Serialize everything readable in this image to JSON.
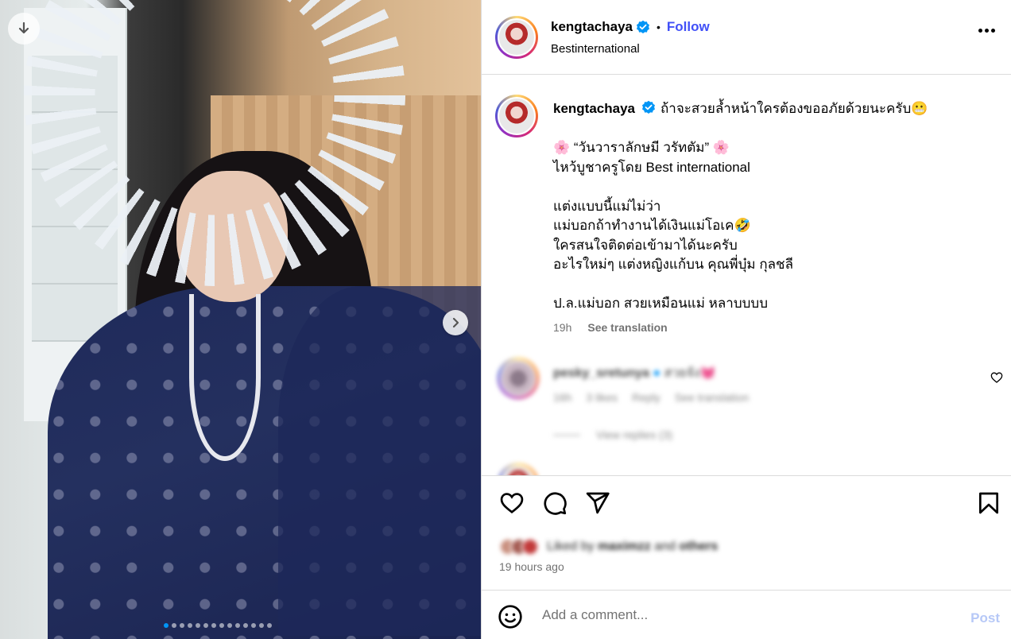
{
  "post": {
    "username": "kengtachaya",
    "follow_label": "Follow",
    "separator": "•",
    "location": "Bestinternational",
    "caption_lines": [
      "ถ้าจะสวยล้ำหน้าใครต้องขออภัยด้วยนะครับ😬",
      "",
      "🌸 “วันวาราลักษมี วรัทตัม” 🌸",
      "ไหว้บูชาครูโดย Best international",
      "",
      "แต่งแบบนี้แม่ไม่ว่า",
      "แม่บอกถ้าทำงานได้เงินแม่โอเค🤣",
      "ใครสนใจติดต่อเข้ามาได้นะครับ",
      "อะไรใหม่ๆ แต่งหญิงแก้บน คุณพี่บุ๋ม กุลชลี",
      "",
      "ป.ล.แม่บอก สวยเหมือนแม่ หลาบบบบ"
    ],
    "caption_time": "19h",
    "see_translation": "See translation",
    "liked_by_prefix": "Liked by",
    "liked_by_user": "maximzz",
    "liked_by_and": "and",
    "liked_by_others": "others",
    "posted_ago": "19 hours ago"
  },
  "comments": [
    {
      "username": "pesky_sretunya",
      "text": "สวยจัง💓",
      "time": "16h",
      "likes": "3 likes",
      "reply": "Reply",
      "see_translation": "See translation",
      "view_replies": "View replies (3)"
    }
  ],
  "composer": {
    "placeholder": "Add a comment...",
    "post_label": "Post"
  },
  "carousel": {
    "slide_count": 14,
    "active_index": 0
  },
  "colors": {
    "follow": "#4150f7",
    "verified": "#0095f6",
    "post_disabled": "#b6c8f7",
    "active_dot": "#0095f6"
  },
  "icons": [
    "download-icon",
    "chevron-right-icon",
    "verified-icon",
    "more-icon",
    "heart-icon",
    "comment-icon",
    "share-icon",
    "bookmark-icon",
    "emoji-icon"
  ]
}
